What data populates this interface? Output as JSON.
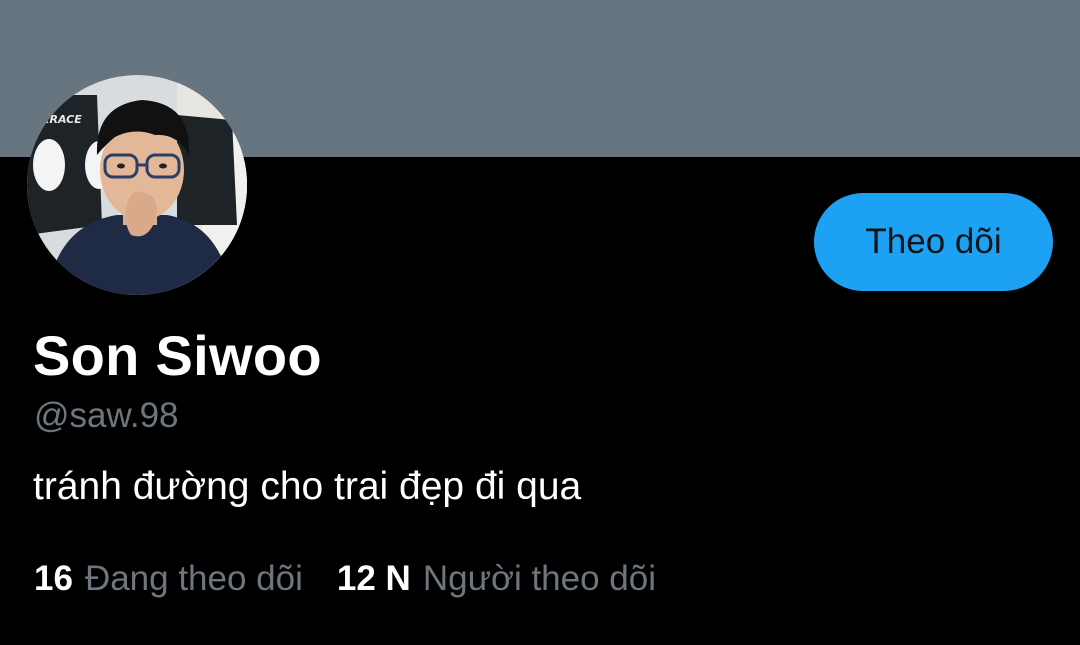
{
  "profile": {
    "display_name": "Son Siwoo",
    "handle": "@saw.98",
    "bio": "tránh đường cho trai đẹp đi qua",
    "follow_button_label": "Theo dõi",
    "avatar_chair_text": "XRACE"
  },
  "stats": {
    "following": {
      "count": "16",
      "label": "Đang theo dõi"
    },
    "followers": {
      "count": "12 N",
      "label": "Người theo dõi"
    }
  },
  "colors": {
    "banner": "#66757f",
    "background": "#000000",
    "accent": "#1da1f2",
    "secondary_text": "#6e767d",
    "primary_text": "#ffffff"
  }
}
